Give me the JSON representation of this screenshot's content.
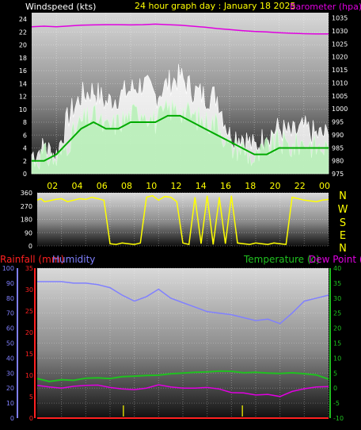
{
  "header": {
    "title": "24 hour graph day : January 18 2025",
    "left_label": "Windspeed (kts)",
    "right_label": "Barometer (hpa)"
  },
  "colors": {
    "background": "#000000",
    "panel_top": "#d8d8d8",
    "panel_bottom": "#101010",
    "wind_gust": "#ffffff",
    "wind_avg": "#b8f0b8",
    "wind_trend": "#00aa00",
    "barometer": "#e000e0",
    "direction": "#ffff00",
    "rainfall": "#ff2020",
    "humidity": "#8080ff",
    "temperature": "#20c020",
    "dewpoint": "#e000e0",
    "time_label": "#ffff00",
    "axis_text": "#ffffff"
  },
  "time_axis": {
    "labels": [
      "02",
      "04",
      "06",
      "08",
      "10",
      "12",
      "14",
      "16",
      "18",
      "20",
      "22",
      "00"
    ]
  },
  "direction_letters": [
    "N",
    "W",
    "S",
    "E",
    "N"
  ],
  "bottom_labels": {
    "rainfall": "Rainfall (mm)",
    "humidity": "Humidity",
    "temperature": "Temperature (c)",
    "dewpoint": "Dew Point (c)"
  },
  "chart_data": [
    {
      "type": "line",
      "name": "wind",
      "title": "24 hour graph day : January 18 2025",
      "ylabel": "Windspeed (kts)",
      "ylim": [
        0,
        25
      ],
      "yticks": [
        0,
        2,
        4,
        6,
        8,
        10,
        12,
        14,
        16,
        18,
        20,
        22,
        24
      ],
      "x": [
        0,
        1,
        2,
        3,
        4,
        5,
        6,
        7,
        8,
        9,
        10,
        11,
        12,
        13,
        14,
        15,
        16,
        17,
        18,
        19,
        20,
        21,
        22,
        23,
        24
      ],
      "series": [
        {
          "key": "gust",
          "values": [
            3,
            4,
            3,
            9,
            12,
            13,
            11,
            12,
            13,
            14,
            12,
            14,
            15,
            13,
            12,
            12,
            6,
            6,
            4,
            6,
            7,
            6,
            7,
            6,
            6
          ]
        },
        {
          "key": "average",
          "values": [
            2,
            3,
            2,
            5,
            8,
            9,
            7,
            8,
            9,
            10,
            8,
            10,
            10,
            9,
            8,
            8,
            4,
            4,
            2,
            4,
            5,
            4,
            5,
            4,
            4
          ]
        },
        {
          "key": "trend",
          "values": [
            2,
            2,
            3,
            5,
            7,
            8,
            7,
            7,
            8,
            8,
            8,
            9,
            9,
            8,
            7,
            6,
            5,
            4,
            3,
            3,
            4,
            4,
            4,
            4,
            4
          ]
        }
      ],
      "y2label": "Barometer (hpa)",
      "y2lim": [
        975,
        1037
      ],
      "y2ticks": [
        975,
        980,
        985,
        990,
        995,
        1000,
        1005,
        1010,
        1015,
        1020,
        1025,
        1030,
        1035
      ],
      "y2series": {
        "key": "barometer",
        "values": [
          1031.6,
          1031.8,
          1031.6,
          1031.9,
          1032.2,
          1032.3,
          1032.4,
          1032.4,
          1032.3,
          1032.4,
          1032.6,
          1032.4,
          1032.2,
          1031.8,
          1031.4,
          1030.9,
          1030.5,
          1030.1,
          1029.8,
          1029.6,
          1029.3,
          1029.1,
          1028.9,
          1028.8,
          1028.8
        ]
      }
    },
    {
      "type": "line",
      "name": "direction",
      "ylim": [
        0,
        360
      ],
      "yticks": [
        0,
        90,
        180,
        270,
        360
      ],
      "x": [
        0,
        0.3,
        0.6,
        1,
        1.5,
        2,
        2.5,
        3,
        3.5,
        4,
        4.5,
        5,
        5.5,
        6,
        6.5,
        7,
        7.5,
        8,
        8.5,
        9,
        9.5,
        10,
        10.5,
        11,
        11.5,
        12,
        12.5,
        13,
        13.5,
        14,
        14.5,
        15,
        15.5,
        16,
        16.5,
        17,
        17.5,
        18,
        18.5,
        19,
        19.5,
        20,
        20.5,
        21,
        21.5,
        22,
        22.5,
        23,
        23.5,
        24
      ],
      "values": [
        310,
        320,
        300,
        305,
        315,
        320,
        300,
        310,
        320,
        315,
        330,
        320,
        310,
        15,
        10,
        20,
        15,
        10,
        20,
        330,
        340,
        310,
        335,
        330,
        300,
        20,
        10,
        330,
        15,
        340,
        10,
        330,
        15,
        340,
        20,
        15,
        10,
        20,
        15,
        10,
        20,
        15,
        10,
        330,
        320,
        310,
        305,
        300,
        310,
        315
      ]
    },
    {
      "type": "line",
      "name": "conditions",
      "x": [
        0,
        1,
        2,
        3,
        4,
        5,
        6,
        7,
        8,
        9,
        10,
        11,
        12,
        13,
        14,
        15,
        16,
        17,
        18,
        19,
        20,
        21,
        22,
        23,
        24
      ],
      "ylim_left_humidity": [
        0,
        100
      ],
      "yticks_humidity": [
        0,
        10,
        20,
        30,
        40,
        50,
        60,
        70,
        80,
        90,
        100
      ],
      "ylim_rain": [
        0,
        35
      ],
      "yticks_rain": [
        0,
        5,
        10,
        15,
        20,
        25,
        30,
        35
      ],
      "ylim_temp": [
        -10,
        40
      ],
      "yticks_temp": [
        -10,
        -5,
        0,
        5,
        10,
        15,
        20,
        25,
        30,
        35,
        40
      ],
      "series": [
        {
          "key": "humidity",
          "values": [
            91,
            91,
            91,
            90,
            90,
            89,
            87,
            82,
            78,
            81,
            86,
            80,
            77,
            74,
            71,
            70,
            69,
            67,
            65,
            66,
            63,
            70,
            78,
            80,
            82
          ]
        },
        {
          "key": "temperature",
          "values": [
            3.2,
            2.2,
            2.8,
            2.6,
            3.3,
            3.4,
            3.2,
            3.8,
            4.0,
            4.2,
            4.3,
            4.8,
            5.0,
            5.3,
            5.4,
            5.7,
            5.6,
            5.1,
            5.3,
            5.0,
            4.9,
            5.1,
            4.8,
            4.4,
            3.0
          ]
        },
        {
          "key": "dewpoint",
          "values": [
            0.9,
            0.4,
            0.0,
            0.6,
            0.9,
            1.0,
            0.2,
            -0.3,
            -0.5,
            0.0,
            1.1,
            0.4,
            0.0,
            0.0,
            0.2,
            -0.3,
            -1.5,
            -1.6,
            -2.3,
            -2.1,
            -2.8,
            -1.1,
            -0.2,
            0.4,
            0.5
          ]
        },
        {
          "key": "rainfall",
          "values": [
            0,
            0,
            0,
            0,
            0,
            0,
            0,
            0,
            0,
            0,
            0,
            0,
            0,
            0,
            0,
            0,
            0,
            0,
            0,
            0,
            0,
            0,
            0,
            0,
            0
          ]
        }
      ]
    }
  ]
}
